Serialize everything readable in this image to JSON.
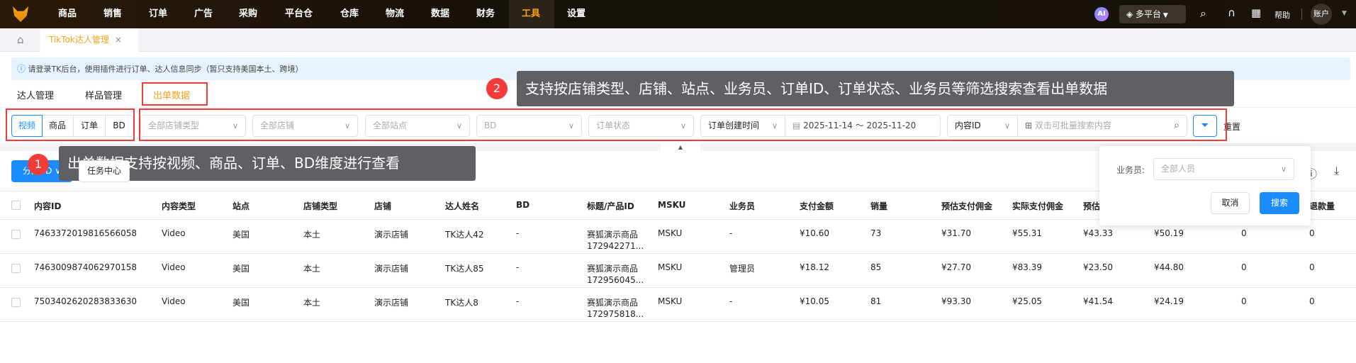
{
  "nav": {
    "items": [
      "商品",
      "销售",
      "订单",
      "广告",
      "采购",
      "平台仓",
      "仓库",
      "物流",
      "数据",
      "财务",
      "工具",
      "设置"
    ],
    "active": "工具",
    "ai": "AI",
    "platform": "多平台",
    "help": "帮助",
    "account": "账户"
  },
  "tabs": {
    "open": "TikTok达人管理",
    "close": "×"
  },
  "info": "请登录TK后台，使用插件进行订单、达人信息同步（暂只支持美国本土、跨境）",
  "subtabs": [
    "达人管理",
    "样品管理",
    "出单数据"
  ],
  "dimensions": [
    "视频",
    "商品",
    "订单",
    "BD"
  ],
  "filters": {
    "store_type": "全部店铺类型",
    "store": "全部店铺",
    "site": "全部站点",
    "bd": "BD",
    "order_status": "订单状态",
    "time_type": "订单创建时间",
    "date_range": "2025-11-14 ～ 2025-11-20",
    "search_type": "内容ID",
    "search_placeholder": "双击可批量搜索内容",
    "reset": "重置"
  },
  "actions": {
    "assign_bd": "分配BD",
    "task_center": "任务中心"
  },
  "tooltips": {
    "one": "出单数据支持按视频、商品、订单、BD维度进行查看",
    "two": "支持按店铺类型、店铺、站点、业务员、订单ID、订单状态、业务员等筛选搜索查看出单数据",
    "n1": "1",
    "n2": "2"
  },
  "popup": {
    "label": "业务员:",
    "placeholder": "全部人员",
    "cancel": "取消",
    "search": "搜索"
  },
  "table": {
    "headers": [
      "内容ID",
      "内容类型",
      "站点",
      "店铺类型",
      "店铺",
      "达人姓名",
      "BD",
      "标题/产品ID",
      "MSKU",
      "业务员",
      "支付金额",
      "销量",
      "预估支付佣金",
      "实际支付佣金",
      "预估",
      "",
      "",
      "退款量"
    ],
    "rows": [
      [
        "7463372019816566058",
        "Video",
        "美国",
        "本土",
        "演示店铺",
        "TK达人42",
        "-",
        "赛狐演示商品",
        "172942271...",
        "MSKU",
        "-",
        "¥10.60",
        "73",
        "¥31.70",
        "¥55.31",
        "¥43.33",
        "¥50.19",
        "0",
        "0"
      ],
      [
        "7463009874062970158",
        "Video",
        "美国",
        "本土",
        "演示店铺",
        "TK达人85",
        "-",
        "赛狐演示商品",
        "172956045...",
        "MSKU",
        "管理员",
        "¥18.12",
        "85",
        "¥27.70",
        "¥83.39",
        "¥23.50",
        "¥44.80",
        "0",
        "0"
      ],
      [
        "7503402620283833630",
        "Video",
        "美国",
        "本土",
        "演示店铺",
        "TK达人8",
        "-",
        "赛狐演示商品",
        "172975818...",
        "MSKU",
        "-",
        "¥10.05",
        "81",
        "¥93.30",
        "¥25.05",
        "¥41.54",
        "¥24.19",
        "0",
        "0"
      ]
    ]
  },
  "colors": {
    "accent": "#1a8cff",
    "brand": "#f7a21b",
    "annotation": "#f23c3c"
  }
}
